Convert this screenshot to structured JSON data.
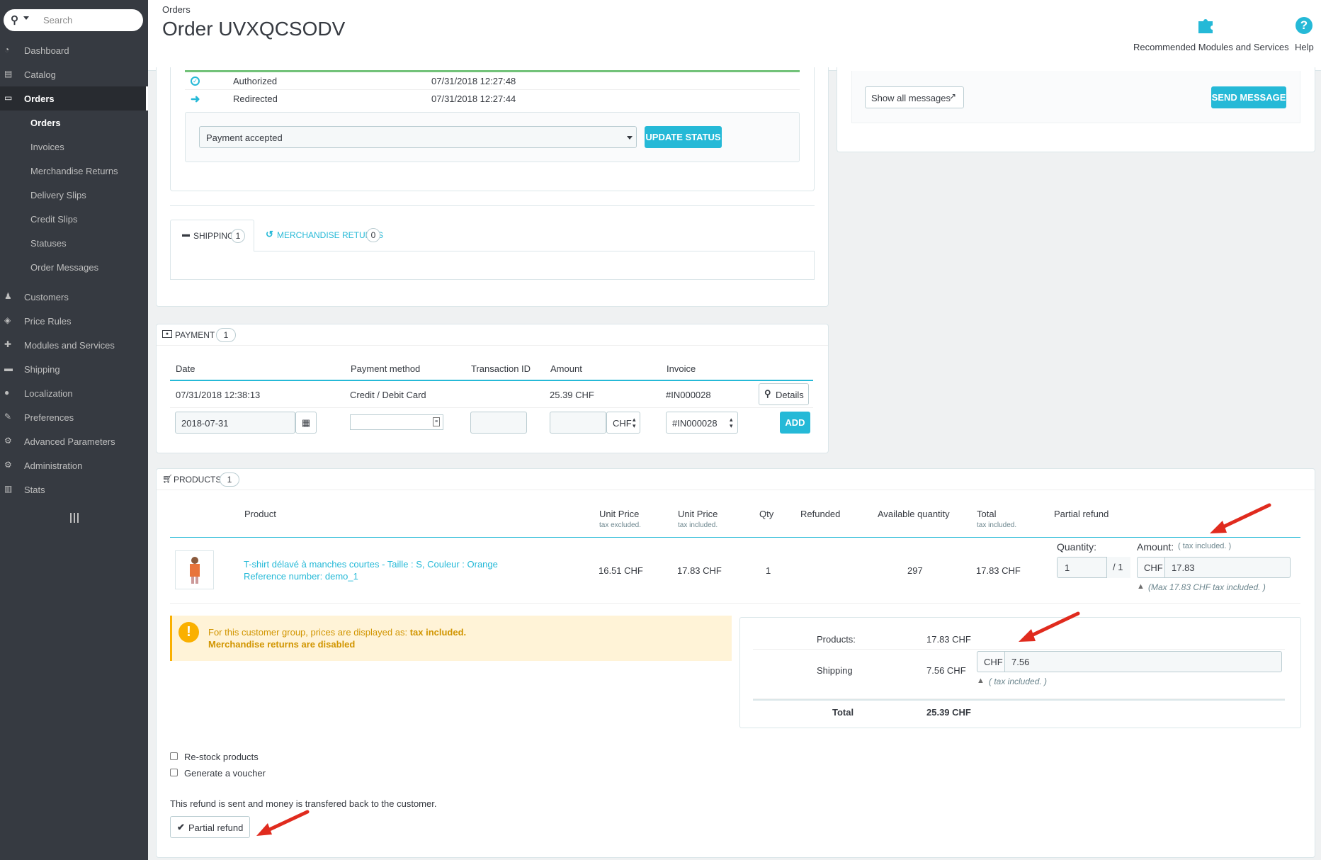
{
  "sidebar": {
    "search_placeholder": "Search",
    "items": [
      {
        "label": "Dashboard",
        "icon": "dashboard-icon"
      },
      {
        "label": "Catalog",
        "icon": "book-icon"
      },
      {
        "label": "Orders",
        "icon": "credit-card-icon"
      },
      {
        "label": "Customers",
        "icon": "users-icon"
      },
      {
        "label": "Price Rules",
        "icon": "tags-icon"
      },
      {
        "label": "Modules and Services",
        "icon": "puzzle-icon"
      },
      {
        "label": "Shipping",
        "icon": "truck-icon"
      },
      {
        "label": "Localization",
        "icon": "globe-icon"
      },
      {
        "label": "Preferences",
        "icon": "wrench-icon"
      },
      {
        "label": "Advanced Parameters",
        "icon": "cogs-icon"
      },
      {
        "label": "Administration",
        "icon": "cog-icon"
      },
      {
        "label": "Stats",
        "icon": "bar-chart-icon"
      }
    ],
    "sub_items": [
      "Orders",
      "Invoices",
      "Merchandise Returns",
      "Delivery Slips",
      "Credit Slips",
      "Statuses",
      "Order Messages"
    ]
  },
  "header": {
    "breadcrumb": "Orders",
    "title": "Order UVXQCSODV",
    "recommended": "Recommended Modules and Services",
    "help": "Help"
  },
  "status_history": [
    {
      "status": "Authorized",
      "date": "07/31/2018 12:27:48"
    },
    {
      "status": "Redirected",
      "date": "07/31/2018 12:27:44"
    }
  ],
  "status_select": "Payment accepted",
  "update_status": "UPDATE STATUS",
  "messages": {
    "show_all": "Show all messages",
    "send": "SEND MESSAGE"
  },
  "tabs": {
    "shipping": "SHIPPING",
    "shipping_count": "1",
    "returns": "MERCHANDISE RETURNS",
    "returns_count": "0"
  },
  "payment": {
    "title": "PAYMENT",
    "count": "1",
    "headers": [
      "Date",
      "Payment method",
      "Transaction ID",
      "Amount",
      "Invoice"
    ],
    "row": {
      "date": "07/31/2018 12:38:13",
      "method": "Credit / Debit Card",
      "transaction": "",
      "amount": "25.39 CHF",
      "invoice": "#IN000028",
      "details": "Details"
    },
    "form": {
      "date": "2018-07-31",
      "currency": "CHF",
      "invoice": "#IN000028",
      "add": "ADD"
    }
  },
  "products": {
    "title": "PRODUCTS",
    "count": "1",
    "headers": {
      "product": "Product",
      "unit_excl": "Unit Price",
      "unit_excl_sub": "tax excluded.",
      "unit_incl": "Unit Price",
      "unit_incl_sub": "tax included.",
      "qty": "Qty",
      "refunded": "Refunded",
      "available": "Available quantity",
      "total": "Total",
      "total_sub": "tax included.",
      "partial": "Partial refund"
    },
    "row": {
      "name": "T-shirt délavé à manches courtes - Taille : S, Couleur : Orange",
      "reference": "Reference number: demo_1",
      "unit_excl": "16.51 CHF",
      "unit_incl": "17.83 CHF",
      "qty": "1",
      "available": "297",
      "total": "17.83 CHF"
    },
    "refund": {
      "quantity_label": "Quantity:",
      "quantity_value": "1",
      "quantity_max": "/ 1",
      "amount_label": "Amount:",
      "amount_note": "( tax included. )",
      "currency": "CHF",
      "amount_value": "17.83",
      "max_note": "(Max 17.83 CHF tax included. )"
    }
  },
  "alert": {
    "text": "For this customer group, prices are displayed as: ",
    "bold": "tax included.",
    "line2": "Merchandise returns are disabled"
  },
  "summary": {
    "products_label": "Products:",
    "products_value": "17.83 CHF",
    "shipping_label": "Shipping",
    "shipping_value": "7.56 CHF",
    "shipping_currency": "CHF",
    "shipping_input": "7.56",
    "shipping_note": "( tax included. )",
    "total_label": "Total",
    "total_value": "25.39 CHF"
  },
  "options": {
    "restock": "Re-stock products",
    "voucher": "Generate a voucher",
    "note": "This refund is sent and money is transfered back to the customer.",
    "button": "Partial refund"
  },
  "colors": {
    "accent": "#25b9d7",
    "sidebar": "#363a41",
    "arrow": "#e02b1e",
    "warning": "#fff3d7"
  }
}
